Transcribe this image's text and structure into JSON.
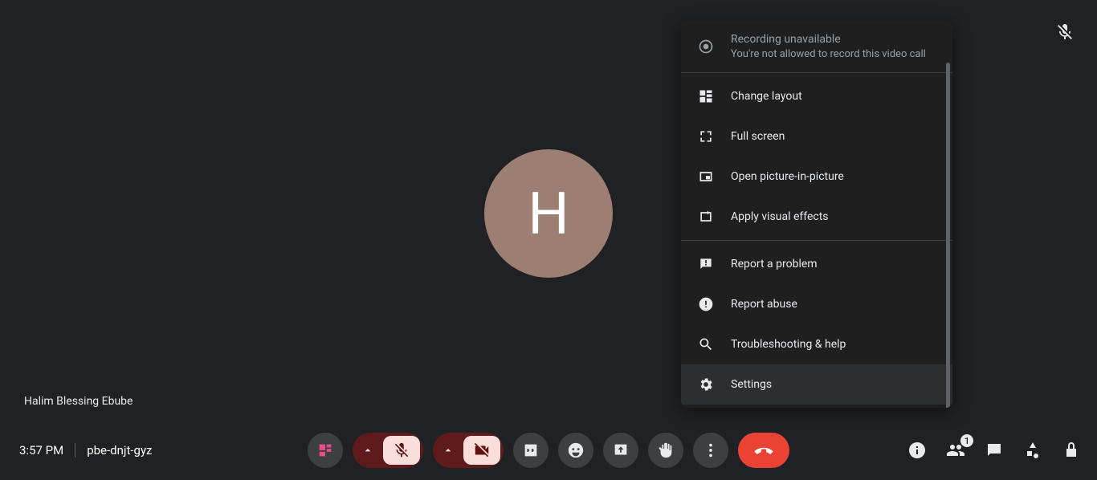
{
  "stage": {
    "participant_name": "Halim Blessing Ebube",
    "avatar_initial": "H"
  },
  "footer": {
    "time": "3:57 PM",
    "meeting_code": "pbe-dnjt-gyz",
    "people_badge": "1"
  },
  "menu": {
    "recording_title": "Recording unavailable",
    "recording_sub": "You're not allowed to record this video call",
    "change_layout": "Change layout",
    "full_screen": "Full screen",
    "picture_in_picture": "Open picture-in-picture",
    "visual_effects": "Apply visual effects",
    "report_problem": "Report a problem",
    "report_abuse": "Report abuse",
    "troubleshooting": "Troubleshooting & help",
    "settings": "Settings"
  }
}
